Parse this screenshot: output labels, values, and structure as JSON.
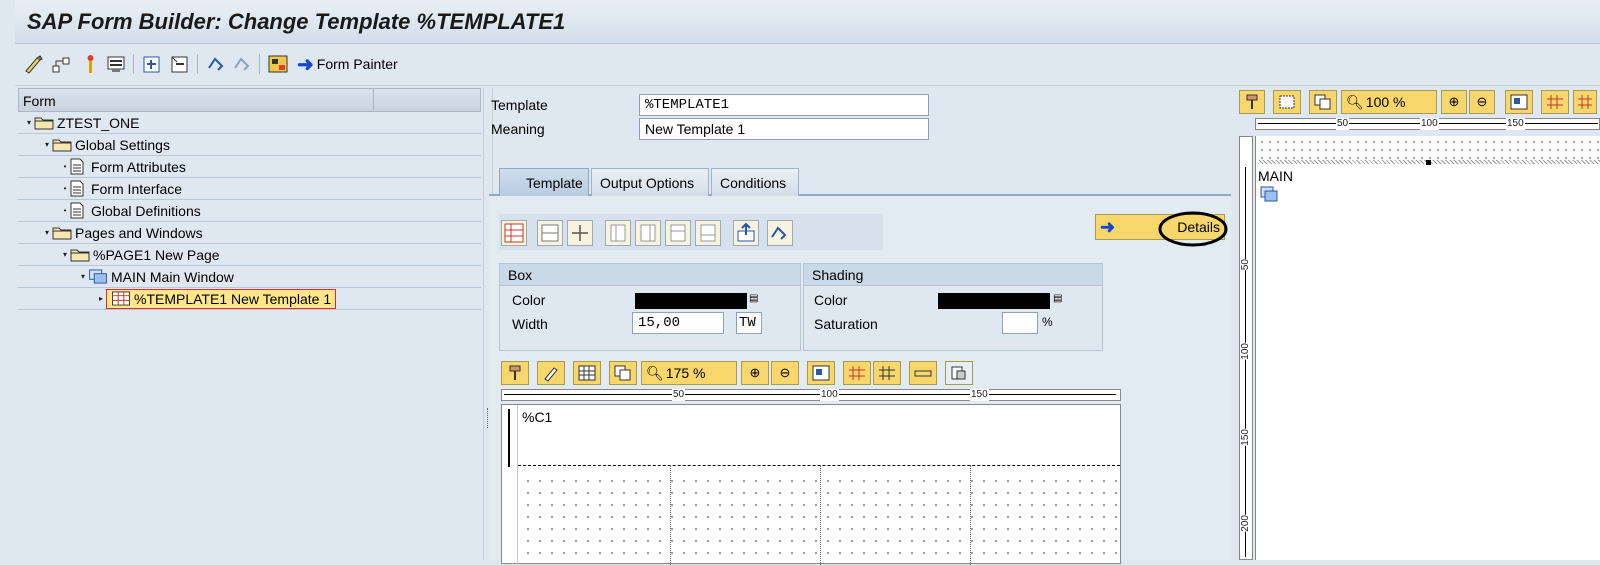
{
  "title": "SAP Form Builder: Change Template %TEMPLATE1",
  "toolbar": {
    "icons": [
      "pen-icon",
      "hierarchy-icon",
      "wand-icon",
      "printer-icon",
      "insert-node-icon",
      "delete-node-icon",
      "undo-icon",
      "redo-icon",
      "form-icon"
    ],
    "form_painter": "Form Painter"
  },
  "tree": {
    "header": "Form",
    "items": [
      {
        "label": "ZTEST_ONE",
        "level": 0,
        "type": "folder"
      },
      {
        "label": "Global Settings",
        "level": 1,
        "type": "folder"
      },
      {
        "label": "Form Attributes",
        "level": 2,
        "type": "doc"
      },
      {
        "label": "Form Interface",
        "level": 2,
        "type": "doc"
      },
      {
        "label": "Global Definitions",
        "level": 2,
        "type": "doc"
      },
      {
        "label": "Pages and Windows",
        "level": 1,
        "type": "folder"
      },
      {
        "label": "%PAGE1 New Page",
        "level": 2,
        "type": "folder"
      },
      {
        "label": "MAIN Main Window",
        "level": 3,
        "type": "window"
      },
      {
        "label": "%TEMPLATE1 New Template 1",
        "level": 4,
        "type": "template",
        "selected": true
      }
    ]
  },
  "header_fields": {
    "template_label": "Template",
    "template_value": "%TEMPLATE1",
    "meaning_label": "Meaning",
    "meaning_value": "New Template 1"
  },
  "tabs": [
    "Template",
    "Output Options",
    "Conditions"
  ],
  "details_button": "Details",
  "box": {
    "title": "Box",
    "color_label": "Color",
    "width_label": "Width",
    "width_value": "15,00",
    "width_unit": "TW"
  },
  "shading": {
    "title": "Shading",
    "color_label": "Color",
    "saturation_label": "Saturation",
    "saturation_value": "",
    "percent": "%"
  },
  "table_painter": {
    "zoom": "175 %",
    "ruler": [
      "50",
      "100",
      "150"
    ],
    "cell_label": "%C1"
  },
  "right_painter": {
    "zoom": "100 %",
    "ruler": [
      "50",
      "100",
      "150"
    ],
    "vruler": [
      "50",
      "100",
      "150",
      "200"
    ],
    "window_label": "MAIN"
  },
  "colors": {
    "selection": "#ffe68a",
    "selection_border": "#e02b2b",
    "accent_blue": "#1446d4"
  }
}
